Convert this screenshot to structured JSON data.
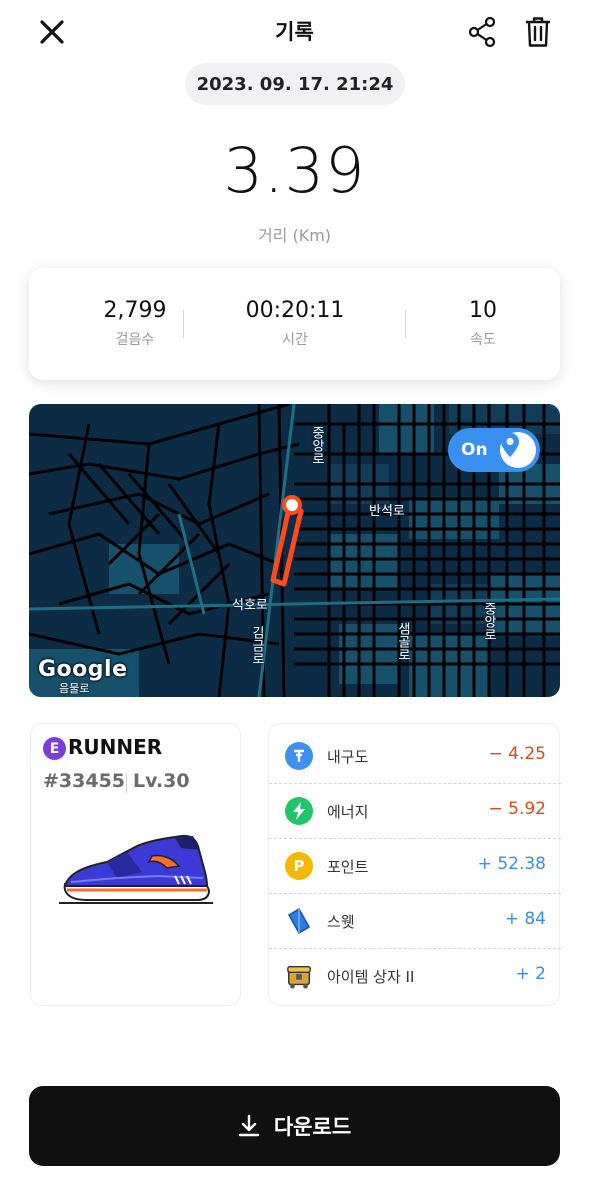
{
  "header": {
    "title": "기록",
    "close_icon": "close-icon",
    "share_icon": "share-icon",
    "trash_icon": "trash-icon"
  },
  "record": {
    "datetime": "2023. 09. 17. 21:24",
    "distance": "3.39",
    "distance_label": "거리 (Km)"
  },
  "stats": [
    {
      "value": "2,799",
      "label": "걸음수"
    },
    {
      "value": "00:20:11",
      "label": "시간"
    },
    {
      "value": "10",
      "label": "속도"
    }
  ],
  "map": {
    "toggle_label": "On",
    "toggle_icon": "location-pin-icon",
    "labels": {
      "road_north": "중앙로",
      "road_banseok": "반석로",
      "road_seokho": "석호로",
      "road_gimgeum": "김금로",
      "road_saemgol": "샘골로",
      "road_jungang": "중앙로",
      "road_bottom": "음물로"
    },
    "attribution": "Google",
    "colors": {
      "background": "#0c2b44",
      "roads": "#000000",
      "route": "#ff4a1c"
    }
  },
  "nft": {
    "badge": "E",
    "type": "RUNNER",
    "id": "#33455",
    "level": "Lv.30",
    "image": "running-shoe-image"
  },
  "rewards": [
    {
      "label": "내구도",
      "value": "− 4.25",
      "icon": "durability-icon",
      "icon_color": "#3f8ff0",
      "sign": "neg"
    },
    {
      "label": "에너지",
      "value": "− 5.92",
      "icon": "energy-icon",
      "icon_color": "#22c46a",
      "sign": "neg"
    },
    {
      "label": "포인트",
      "value": "+ 52.38",
      "icon": "point-icon",
      "icon_color": "#f5b800",
      "icon_text": "P",
      "sign": "pos"
    },
    {
      "label": "스웻",
      "value": "+ 84",
      "icon": "sweat-crystal-icon",
      "icon_color": "#2c7de0",
      "sign": "pos"
    },
    {
      "label": "아이템 상자 II",
      "value": "+ 2",
      "icon": "item-box-icon",
      "icon_color": "#d9a43a",
      "sign": "pos"
    }
  ],
  "download": {
    "label": "다운로드",
    "icon": "download-icon"
  }
}
